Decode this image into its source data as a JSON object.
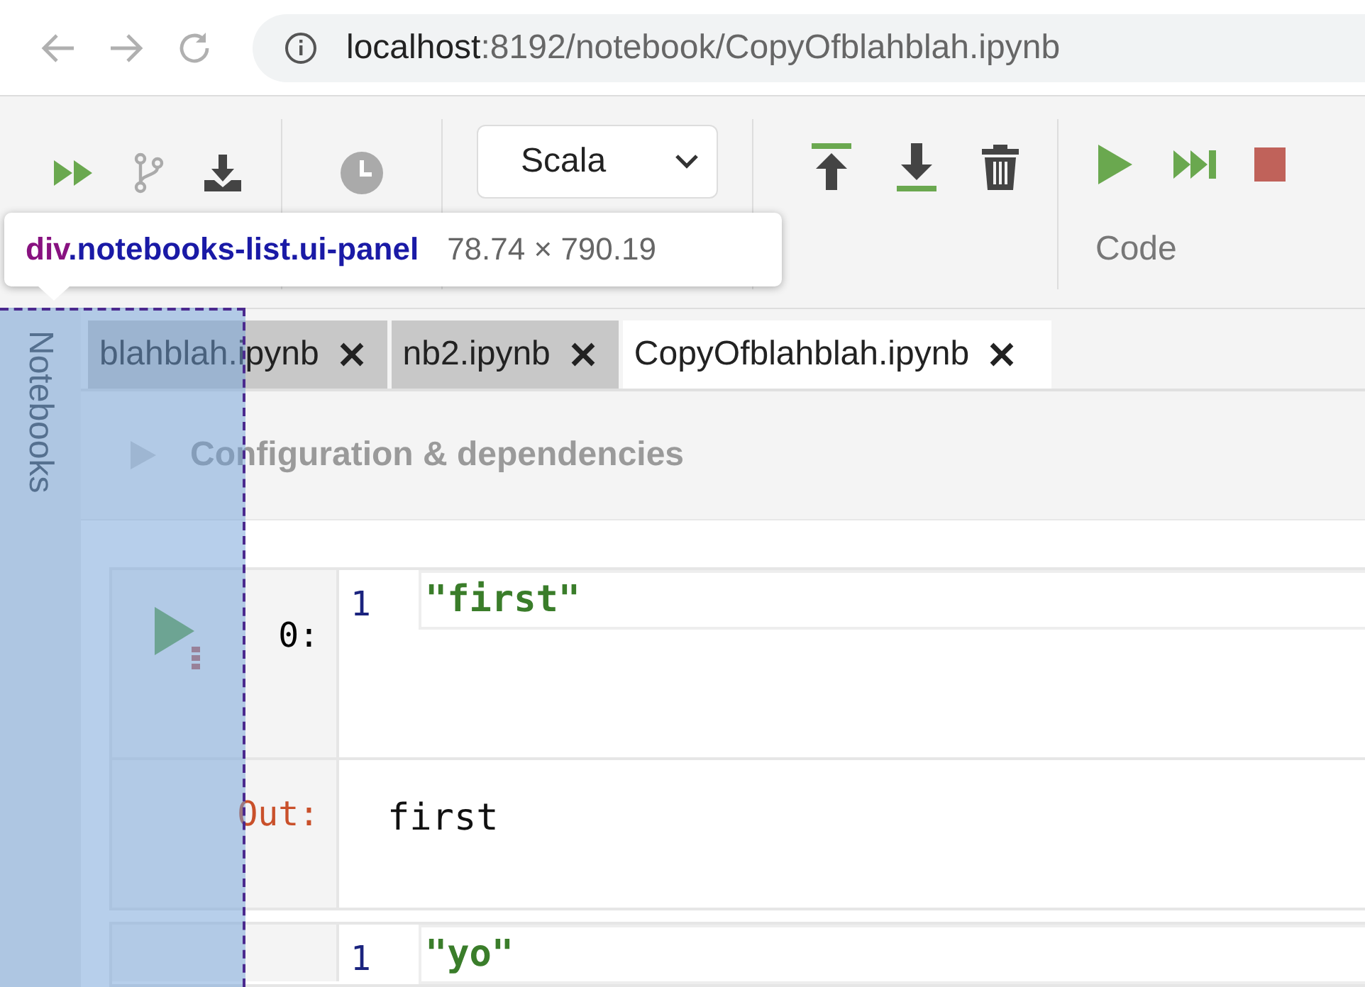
{
  "browser": {
    "url_host": "localhost",
    "url_path": ":8192/notebook/CopyOfblahblah.ipynb"
  },
  "toolbar": {
    "language_select": {
      "value": "Scala"
    },
    "section_label": "Code"
  },
  "inspector_tooltip": {
    "tag": "div",
    "classes": ".notebooks-list.ui-panel",
    "size": "78.74 × 790.19"
  },
  "sidebar": {
    "label": "Notebooks"
  },
  "tabs": [
    {
      "label": "blahblah.ipynb",
      "selected": false
    },
    {
      "label": "nb2.ipynb",
      "selected": false
    },
    {
      "label": "CopyOfblahblah.ipynb",
      "selected": true
    }
  ],
  "config": {
    "title": "Configuration & dependencies",
    "expanded": false
  },
  "cells": [
    {
      "prompt": "0:",
      "lines": [
        {
          "number": "1",
          "code": "\"first\""
        }
      ],
      "output": {
        "prompt": "Out:",
        "text": "first"
      }
    },
    {
      "lines": [
        {
          "number": "1",
          "code": "\"yo\""
        }
      ]
    }
  ]
}
